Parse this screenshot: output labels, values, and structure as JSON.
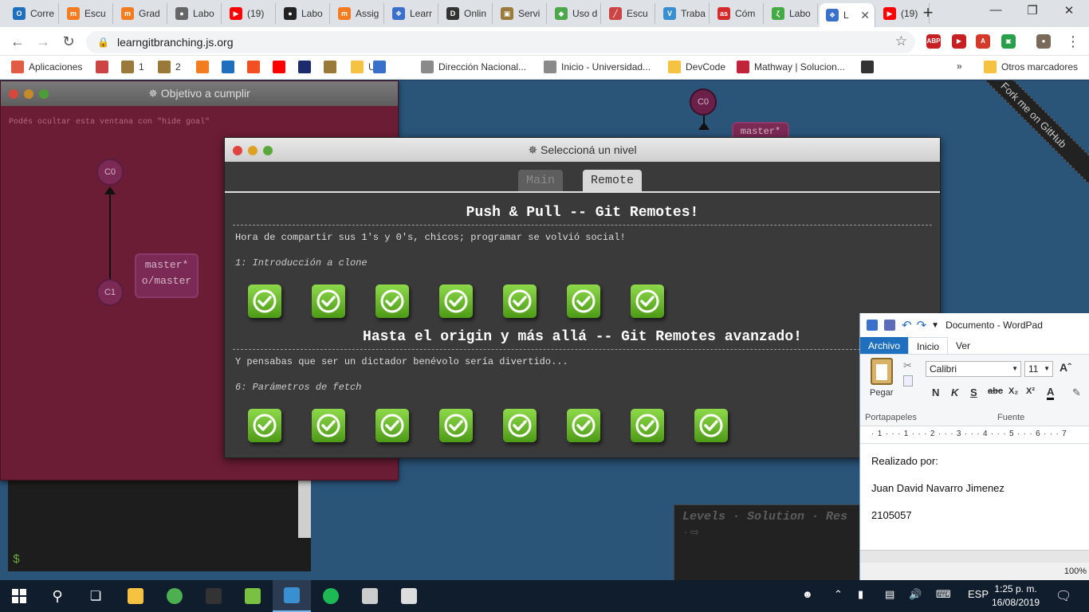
{
  "browser": {
    "tabs": [
      {
        "label": "Corre",
        "color": "#1e6fbd",
        "glyph": "O"
      },
      {
        "label": "Escu",
        "color": "#f47c20",
        "glyph": "m"
      },
      {
        "label": "Grad",
        "color": "#f47c20",
        "glyph": "m"
      },
      {
        "label": "Labo",
        "color": "#666666",
        "glyph": "●"
      },
      {
        "label": "(19) ",
        "color": "#ff0000",
        "glyph": "▶"
      },
      {
        "label": "Labo",
        "color": "#222222",
        "glyph": "●"
      },
      {
        "label": "Assig",
        "color": "#f47c20",
        "glyph": "m"
      },
      {
        "label": "Learr",
        "color": "#3a70c9",
        "glyph": "❖"
      },
      {
        "label": "Onlin",
        "color": "#333333",
        "glyph": "D"
      },
      {
        "label": "Servi",
        "color": "#9a7a3a",
        "glyph": "▣"
      },
      {
        "label": "Uso d",
        "color": "#4aa84a",
        "glyph": "◆"
      },
      {
        "label": "Escu",
        "color": "#cc4444",
        "glyph": "╱"
      },
      {
        "label": "Traba",
        "color": "#3a8fd0",
        "glyph": "V"
      },
      {
        "label": "Cóm",
        "color": "#d42a2a",
        "glyph": "as"
      },
      {
        "label": "Labo",
        "color": "#44aa44",
        "glyph": "ζ"
      },
      {
        "label": "L",
        "color": "#3a70c9",
        "glyph": "❖"
      },
      {
        "label": "(19) ",
        "color": "#ff0000",
        "glyph": "▶"
      }
    ],
    "new_tab": "+",
    "window_controls": [
      "—",
      "❐",
      "✕"
    ],
    "url": "learngitbranching.js.org",
    "nav": {
      "back": "←",
      "forward": "→",
      "reload": "↻"
    },
    "extensions": [
      {
        "label": "ABP",
        "color": "#c61f24"
      },
      {
        "label": "▶",
        "color": "#c61f24"
      },
      {
        "label": "A",
        "color": "#d33a2c"
      },
      {
        "label": "▣",
        "color": "#2a9d4a"
      },
      {
        "label": "●",
        "color": "#7a6a5a"
      }
    ],
    "bookmarks": [
      {
        "label": "Aplicaciones",
        "color": "#e25b45"
      },
      {
        "label": "",
        "color": "#cc4444"
      },
      {
        "label": "1",
        "color": "#9a7a3a"
      },
      {
        "label": "2",
        "color": "#9a7a3a"
      },
      {
        "label": "",
        "color": "#f47c20"
      },
      {
        "label": "",
        "color": "#1e6fbd"
      },
      {
        "label": "",
        "color": "#f25022"
      },
      {
        "label": "",
        "color": "#ff0000"
      },
      {
        "label": "",
        "color": "#1d2a6b"
      },
      {
        "label": "",
        "color": "#9a7a3a"
      },
      {
        "label": "UN",
        "color": "#f5c242"
      },
      {
        "label": "",
        "color": "#3a70c9"
      },
      {
        "label": "Dirección Nacional...",
        "color": "#8a8a8a"
      },
      {
        "label": "Inicio - Universidad...",
        "color": "#8a8a8a"
      },
      {
        "label": "DevCode",
        "color": "#f5c242"
      },
      {
        "label": "Mathway | Solucion...",
        "color": "#c0243a"
      },
      {
        "label": "",
        "color": "#333333"
      }
    ],
    "bookmarks_more": "»",
    "other_bookmarks": "Otros marcadores"
  },
  "goal_window": {
    "title": "✵ Objetivo a cumplir",
    "hint": "Podés ocultar esta ventana con \"hide goal\"",
    "nodes": [
      "C0",
      "C1"
    ],
    "branch_label_1": "master*",
    "branch_label_2": "o/master"
  },
  "terminal": {
    "prompt": "$"
  },
  "background": {
    "node": "C0",
    "branch": "master*",
    "ribbon": "Fork me on GitHub",
    "levels_box": "Levels · Solution · Res",
    "levels_dot": "· ⇨"
  },
  "level_dialog": {
    "title": "✵ Seleccioná un nivel",
    "tabs": [
      {
        "label": "Main",
        "active": false
      },
      {
        "label": "Remote",
        "active": true
      }
    ],
    "sections": [
      {
        "heading": "Push & Pull -- Git Remotes!",
        "description": "Hora de compartir sus 1's y 0's, chicos; programar se volvió social!",
        "subtitle": "1: Introducción a clone",
        "level_count": 7
      },
      {
        "heading": "Hasta el origin y más allá -- Git Remotes avanzado!",
        "description": "Y pensabas que ser un dictador benévolo sería divertido...",
        "subtitle": "6: Parámetros de fetch",
        "level_count": 8
      }
    ]
  },
  "wordpad": {
    "title": "Documento - WordPad",
    "menu": [
      "Archivo",
      "Inicio",
      "Ver"
    ],
    "paste": "Pegar",
    "font": "Calibri",
    "size": "11",
    "format_buttons": [
      "N",
      "K",
      "S",
      "abc",
      "X₂",
      "X²",
      "A"
    ],
    "group_clipboard": "Portapapeles",
    "group_font": "Fuente",
    "ruler": "· 1 · · · 1 · · · 2 · · · 3 · · · 4 · · · 5 · · · 6 · · · 7",
    "lines": [
      "Realizado por:",
      "Juan David Navarro Jimenez",
      "2105057"
    ],
    "zoom": "100%"
  },
  "taskbar": {
    "apps": [
      {
        "name": "file-explorer",
        "color": "#f5c242"
      },
      {
        "name": "chrome",
        "color": "#4caf50"
      },
      {
        "name": "cmd",
        "color": "#333333"
      },
      {
        "name": "notepad",
        "color": "#7ac142"
      },
      {
        "name": "wordpad",
        "color": "#3a8fd0"
      },
      {
        "name": "spotify",
        "color": "#1db954"
      },
      {
        "name": "app-7",
        "color": "#cccccc"
      },
      {
        "name": "app-8",
        "color": "#dddddd"
      }
    ],
    "language": "ESP",
    "time": "1:25 p. m.",
    "date": "16/08/2019"
  }
}
